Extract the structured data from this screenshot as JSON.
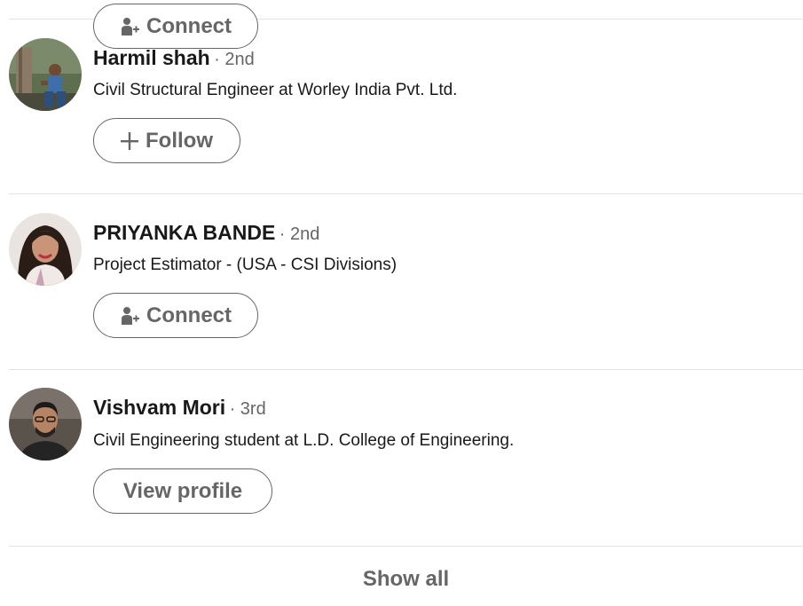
{
  "people": [
    {
      "name": "Harmil shah",
      "degree": "· 2nd",
      "headline": "Civil Structural Engineer at Worley India Pvt. Ltd.",
      "action_label": "Follow",
      "action_icon": "plus-icon"
    },
    {
      "name": "PRIYANKA BANDE",
      "degree": "· 2nd",
      "headline": "Project Estimator - (USA - CSI Divisions)",
      "action_label": "Connect",
      "action_icon": "add-person-icon"
    },
    {
      "name": "Vishvam Mori",
      "degree": "· 3rd",
      "headline": "Civil Engineering student at L.D. College of Engineering.",
      "action_label": "View profile",
      "action_icon": ""
    }
  ],
  "top_partial_button": {
    "label": "Connect",
    "icon": "add-person-icon"
  },
  "footer": {
    "show_all_label": "Show all"
  },
  "colors": {
    "text": "#191919",
    "secondary_text": "#666666",
    "divider": "#e3e3e3",
    "button_border": "#666666"
  }
}
